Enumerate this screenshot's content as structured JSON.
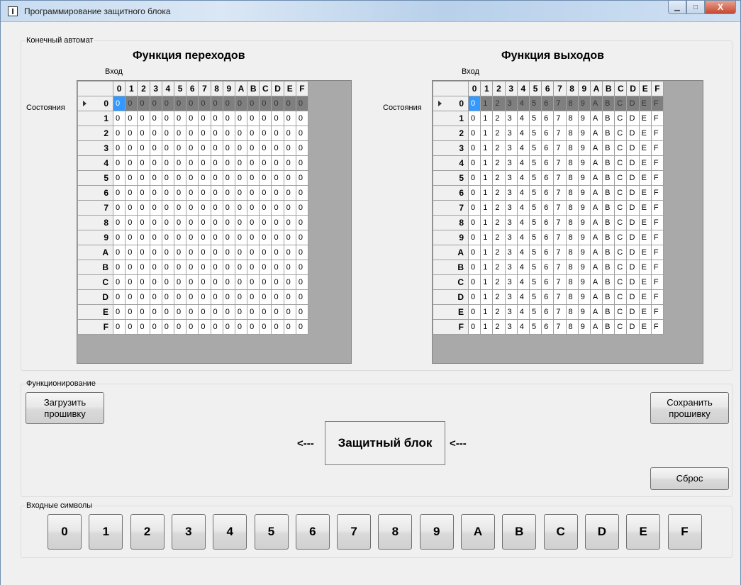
{
  "window": {
    "title": "Программирование защитного блока",
    "controls": {
      "minimize": "▁",
      "maximize": "□",
      "close": "X"
    }
  },
  "fsm": {
    "group_label": "Конечный автомат",
    "transitions": {
      "title": "Функция переходов",
      "input_label": "Вход",
      "states_label": "Состояния"
    },
    "outputs": {
      "title": "Функция выходов",
      "input_label": "Вход",
      "states_label": "Состояния"
    },
    "columns": [
      "0",
      "1",
      "2",
      "3",
      "4",
      "5",
      "6",
      "7",
      "8",
      "9",
      "A",
      "B",
      "C",
      "D",
      "E",
      "F"
    ],
    "rows": [
      "0",
      "1",
      "2",
      "3",
      "4",
      "5",
      "6",
      "7",
      "8",
      "9",
      "A",
      "B",
      "C",
      "D",
      "E",
      "F"
    ],
    "transition_values": [
      [
        "0",
        "0",
        "0",
        "0",
        "0",
        "0",
        "0",
        "0",
        "0",
        "0",
        "0",
        "0",
        "0",
        "0",
        "0",
        "0"
      ],
      [
        "0",
        "0",
        "0",
        "0",
        "0",
        "0",
        "0",
        "0",
        "0",
        "0",
        "0",
        "0",
        "0",
        "0",
        "0",
        "0"
      ],
      [
        "0",
        "0",
        "0",
        "0",
        "0",
        "0",
        "0",
        "0",
        "0",
        "0",
        "0",
        "0",
        "0",
        "0",
        "0",
        "0"
      ],
      [
        "0",
        "0",
        "0",
        "0",
        "0",
        "0",
        "0",
        "0",
        "0",
        "0",
        "0",
        "0",
        "0",
        "0",
        "0",
        "0"
      ],
      [
        "0",
        "0",
        "0",
        "0",
        "0",
        "0",
        "0",
        "0",
        "0",
        "0",
        "0",
        "0",
        "0",
        "0",
        "0",
        "0"
      ],
      [
        "0",
        "0",
        "0",
        "0",
        "0",
        "0",
        "0",
        "0",
        "0",
        "0",
        "0",
        "0",
        "0",
        "0",
        "0",
        "0"
      ],
      [
        "0",
        "0",
        "0",
        "0",
        "0",
        "0",
        "0",
        "0",
        "0",
        "0",
        "0",
        "0",
        "0",
        "0",
        "0",
        "0"
      ],
      [
        "0",
        "0",
        "0",
        "0",
        "0",
        "0",
        "0",
        "0",
        "0",
        "0",
        "0",
        "0",
        "0",
        "0",
        "0",
        "0"
      ],
      [
        "0",
        "0",
        "0",
        "0",
        "0",
        "0",
        "0",
        "0",
        "0",
        "0",
        "0",
        "0",
        "0",
        "0",
        "0",
        "0"
      ],
      [
        "0",
        "0",
        "0",
        "0",
        "0",
        "0",
        "0",
        "0",
        "0",
        "0",
        "0",
        "0",
        "0",
        "0",
        "0",
        "0"
      ],
      [
        "0",
        "0",
        "0",
        "0",
        "0",
        "0",
        "0",
        "0",
        "0",
        "0",
        "0",
        "0",
        "0",
        "0",
        "0",
        "0"
      ],
      [
        "0",
        "0",
        "0",
        "0",
        "0",
        "0",
        "0",
        "0",
        "0",
        "0",
        "0",
        "0",
        "0",
        "0",
        "0",
        "0"
      ],
      [
        "0",
        "0",
        "0",
        "0",
        "0",
        "0",
        "0",
        "0",
        "0",
        "0",
        "0",
        "0",
        "0",
        "0",
        "0",
        "0"
      ],
      [
        "0",
        "0",
        "0",
        "0",
        "0",
        "0",
        "0",
        "0",
        "0",
        "0",
        "0",
        "0",
        "0",
        "0",
        "0",
        "0"
      ],
      [
        "0",
        "0",
        "0",
        "0",
        "0",
        "0",
        "0",
        "0",
        "0",
        "0",
        "0",
        "0",
        "0",
        "0",
        "0",
        "0"
      ],
      [
        "0",
        "0",
        "0",
        "0",
        "0",
        "0",
        "0",
        "0",
        "0",
        "0",
        "0",
        "0",
        "0",
        "0",
        "0",
        "0"
      ]
    ],
    "output_values": [
      [
        "0",
        "1",
        "2",
        "3",
        "4",
        "5",
        "6",
        "7",
        "8",
        "9",
        "A",
        "B",
        "C",
        "D",
        "E",
        "F"
      ],
      [
        "0",
        "1",
        "2",
        "3",
        "4",
        "5",
        "6",
        "7",
        "8",
        "9",
        "A",
        "B",
        "C",
        "D",
        "E",
        "F"
      ],
      [
        "0",
        "1",
        "2",
        "3",
        "4",
        "5",
        "6",
        "7",
        "8",
        "9",
        "A",
        "B",
        "C",
        "D",
        "E",
        "F"
      ],
      [
        "0",
        "1",
        "2",
        "3",
        "4",
        "5",
        "6",
        "7",
        "8",
        "9",
        "A",
        "B",
        "C",
        "D",
        "E",
        "F"
      ],
      [
        "0",
        "1",
        "2",
        "3",
        "4",
        "5",
        "6",
        "7",
        "8",
        "9",
        "A",
        "B",
        "C",
        "D",
        "E",
        "F"
      ],
      [
        "0",
        "1",
        "2",
        "3",
        "4",
        "5",
        "6",
        "7",
        "8",
        "9",
        "A",
        "B",
        "C",
        "D",
        "E",
        "F"
      ],
      [
        "0",
        "1",
        "2",
        "3",
        "4",
        "5",
        "6",
        "7",
        "8",
        "9",
        "A",
        "B",
        "C",
        "D",
        "E",
        "F"
      ],
      [
        "0",
        "1",
        "2",
        "3",
        "4",
        "5",
        "6",
        "7",
        "8",
        "9",
        "A",
        "B",
        "C",
        "D",
        "E",
        "F"
      ],
      [
        "0",
        "1",
        "2",
        "3",
        "4",
        "5",
        "6",
        "7",
        "8",
        "9",
        "A",
        "B",
        "C",
        "D",
        "E",
        "F"
      ],
      [
        "0",
        "1",
        "2",
        "3",
        "4",
        "5",
        "6",
        "7",
        "8",
        "9",
        "A",
        "B",
        "C",
        "D",
        "E",
        "F"
      ],
      [
        "0",
        "1",
        "2",
        "3",
        "4",
        "5",
        "6",
        "7",
        "8",
        "9",
        "A",
        "B",
        "C",
        "D",
        "E",
        "F"
      ],
      [
        "0",
        "1",
        "2",
        "3",
        "4",
        "5",
        "6",
        "7",
        "8",
        "9",
        "A",
        "B",
        "C",
        "D",
        "E",
        "F"
      ],
      [
        "0",
        "1",
        "2",
        "3",
        "4",
        "5",
        "6",
        "7",
        "8",
        "9",
        "A",
        "B",
        "C",
        "D",
        "E",
        "F"
      ],
      [
        "0",
        "1",
        "2",
        "3",
        "4",
        "5",
        "6",
        "7",
        "8",
        "9",
        "A",
        "B",
        "C",
        "D",
        "E",
        "F"
      ],
      [
        "0",
        "1",
        "2",
        "3",
        "4",
        "5",
        "6",
        "7",
        "8",
        "9",
        "A",
        "B",
        "C",
        "D",
        "E",
        "F"
      ],
      [
        "0",
        "1",
        "2",
        "3",
        "4",
        "5",
        "6",
        "7",
        "8",
        "9",
        "A",
        "B",
        "C",
        "D",
        "E",
        "F"
      ]
    ],
    "selected_row": "0"
  },
  "operation": {
    "group_label": "Функционирование",
    "load_button": "Загрузить прошивку",
    "save_button": "Сохранить прошивку",
    "block_label": "Защитный блок",
    "arrow_left": "<---",
    "arrow_right": "<---",
    "reset_button": "Сброс"
  },
  "input_symbols": {
    "group_label": "Входные символы",
    "symbols": [
      "0",
      "1",
      "2",
      "3",
      "4",
      "5",
      "6",
      "7",
      "8",
      "9",
      "A",
      "B",
      "C",
      "D",
      "E",
      "F"
    ]
  }
}
